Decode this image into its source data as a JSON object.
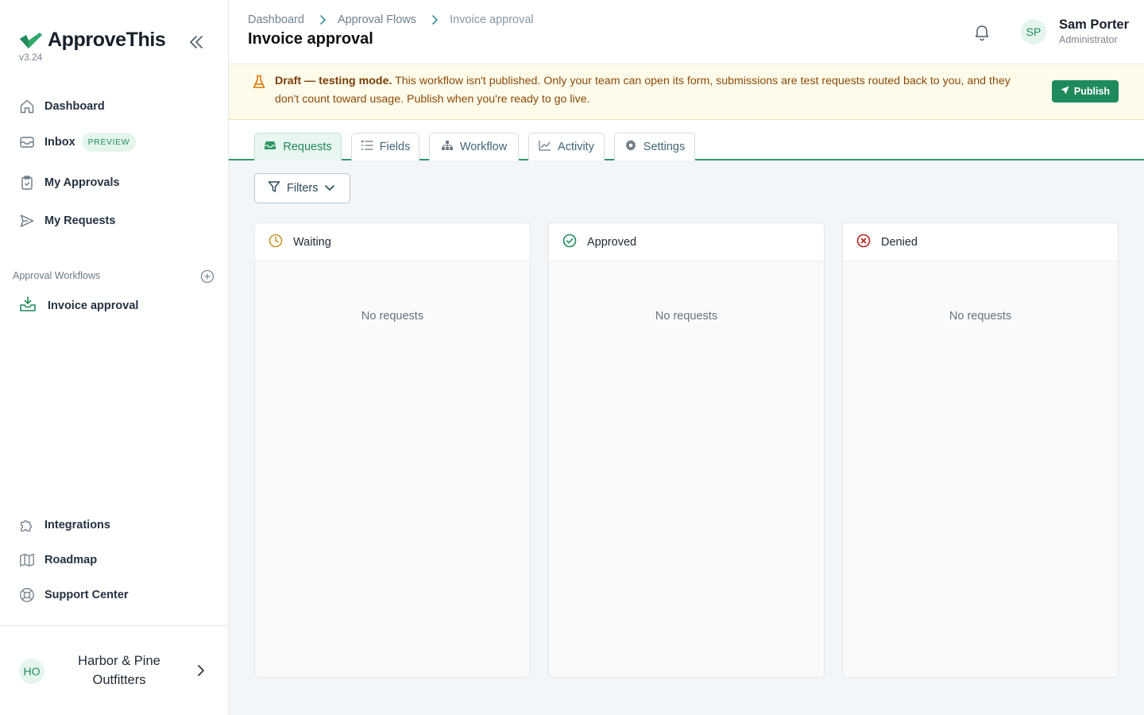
{
  "app": {
    "brand": "ApproveThis",
    "version": "v3.24"
  },
  "sidebar": {
    "nav": [
      {
        "label": "Dashboard",
        "icon": "home-icon"
      },
      {
        "label": "Inbox",
        "icon": "inbox-icon",
        "badge": "PREVIEW"
      },
      {
        "label": "My Approvals",
        "icon": "clipboard-check-icon"
      },
      {
        "label": "My Requests",
        "icon": "send-icon"
      }
    ],
    "workflows_title": "Approval Workflows",
    "workflows": [
      {
        "label": "Invoice approval",
        "icon": "inbox-download-icon"
      }
    ],
    "bottom": [
      {
        "label": "Integrations",
        "icon": "puzzle-icon"
      },
      {
        "label": "Roadmap",
        "icon": "map-icon"
      },
      {
        "label": "Support Center",
        "icon": "lifebuoy-icon"
      }
    ],
    "org": {
      "initials": "HO",
      "name": "Harbor & Pine Outfitters"
    }
  },
  "header": {
    "breadcrumbs": [
      "Dashboard",
      "Approval Flows",
      "Invoice approval"
    ],
    "title": "Invoice approval",
    "user": {
      "initials": "SP",
      "name": "Sam Porter",
      "role": "Administrator"
    }
  },
  "banner": {
    "lead": "Draft — testing mode.",
    "text": "This workflow isn't published. Only your team can open its form, submissions are test requests routed back to you, and they don't count toward usage. Publish when you're ready to go live.",
    "button": "Publish"
  },
  "tabs": [
    {
      "label": "Requests",
      "icon": "tray-icon",
      "active": true
    },
    {
      "label": "Fields",
      "icon": "list-checks-icon",
      "active": false
    },
    {
      "label": "Workflow",
      "icon": "flow-tree-icon",
      "active": false
    },
    {
      "label": "Activity",
      "icon": "chart-line-icon",
      "active": false
    },
    {
      "label": "Settings",
      "icon": "gear-icon",
      "active": false
    }
  ],
  "filters": {
    "label": "Filters"
  },
  "columns": [
    {
      "title": "Waiting",
      "icon": "clock-icon",
      "empty": "No requests"
    },
    {
      "title": "Approved",
      "icon": "check-circle-icon",
      "empty": "No requests"
    },
    {
      "title": "Denied",
      "icon": "x-circle-icon",
      "empty": "No requests"
    }
  ],
  "colors": {
    "accent": "#1f8a5b",
    "waiting": "#c9962a",
    "approved": "#1f8a5b",
    "denied": "#b42318",
    "banner_bg": "#fffbeb"
  }
}
